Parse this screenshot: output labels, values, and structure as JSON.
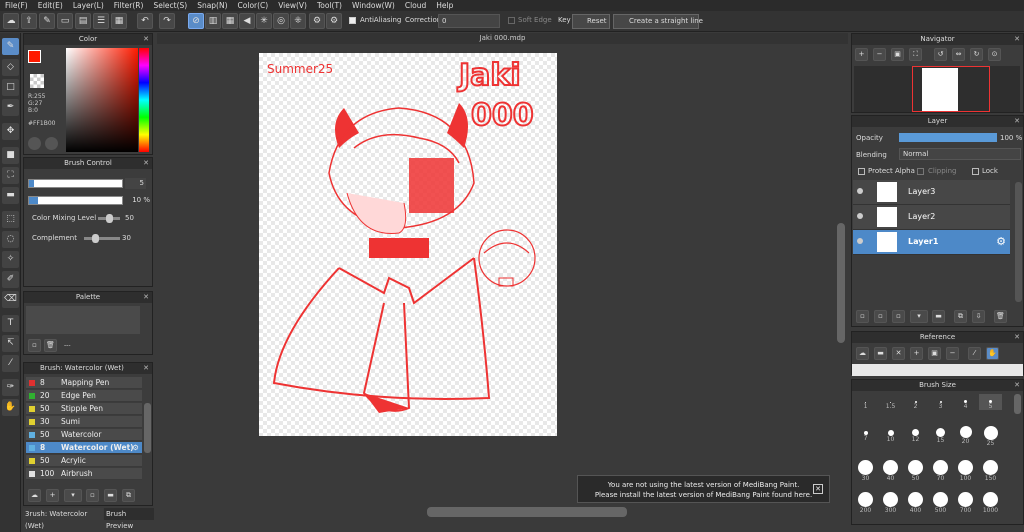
{
  "menu": [
    "File(F)",
    "Edit(E)",
    "Layer(L)",
    "Filter(R)",
    "Select(S)",
    "Snap(N)",
    "Color(C)",
    "View(V)",
    "Tool(T)",
    "Window(W)",
    "Cloud",
    "Help"
  ],
  "toolbar": {
    "antialiasing": "AntiAliasing",
    "correction_label": "Correction",
    "correction_value": "0",
    "soft_edge": "Soft Edge",
    "key": "Key",
    "reset": "Reset",
    "straight": "Create a straight line"
  },
  "canvas_title": "Jaki 000.mdp",
  "artwork": {
    "corner_text": "Summer25",
    "title_line1": "Jaki",
    "title_line2": "000"
  },
  "color_panel": {
    "title": "Color",
    "r": "R:255",
    "g": "G:27",
    "b": "B:0",
    "hex": "#FF1B00",
    "accent": "#ff1b00"
  },
  "brush_control": {
    "title": "Brush Control",
    "size": "5",
    "opacity": "10 %",
    "mixing_label": "Color Mixing Level",
    "mixing_value": "50",
    "complement_label": "Complement",
    "complement_value": "30"
  },
  "palette": {
    "title": "Palette",
    "ellipsis": "---"
  },
  "brush_list": {
    "title": "Brush: Watercolor (Wet)",
    "items": [
      {
        "size": "8",
        "name": "Mapping Pen",
        "color": "#e03030"
      },
      {
        "size": "20",
        "name": "Edge Pen",
        "color": "#30b030"
      },
      {
        "size": "50",
        "name": "Stipple Pen",
        "color": "#e0d030"
      },
      {
        "size": "30",
        "name": "Sumi",
        "color": "#e0d030"
      },
      {
        "size": "50",
        "name": "Watercolor",
        "color": "#60b0e0"
      },
      {
        "size": "8",
        "name": "Watercolor (Wet)",
        "color": "#60b0e0"
      },
      {
        "size": "50",
        "name": "Acrylic",
        "color": "#e0d030"
      },
      {
        "size": "100",
        "name": "Airbrush",
        "color": "#e0e0e0"
      }
    ]
  },
  "bottom_tabs": {
    "tab1": "3rush: Watercolor (Wet)",
    "tab2": "Brush Preview"
  },
  "navigator": {
    "title": "Navigator"
  },
  "layer_panel": {
    "title": "Layer",
    "opacity_label": "Opacity",
    "opacity_value": "100 %",
    "blending_label": "Blending",
    "blending_value": "Normal",
    "protect_alpha": "Protect Alpha",
    "clipping": "Clipping",
    "lock": "Lock",
    "layers": [
      "Layer3",
      "Layer2",
      "Layer1"
    ]
  },
  "reference": {
    "title": "Reference"
  },
  "brush_size": {
    "title": "Brush Size",
    "row1": [
      "1",
      "1.5",
      "2",
      "3",
      "4",
      "5"
    ],
    "row2": [
      "7",
      "10",
      "12",
      "15",
      "20",
      "25"
    ],
    "row3": [
      "30",
      "40",
      "50",
      "70",
      "100",
      "150"
    ],
    "row4": [
      "200",
      "300",
      "400",
      "500",
      "700",
      "1000"
    ]
  },
  "notification": {
    "line1": "You are not using the latest version of MediBang Paint.",
    "line2": "Please install the latest version of MediBang Paint found here."
  }
}
